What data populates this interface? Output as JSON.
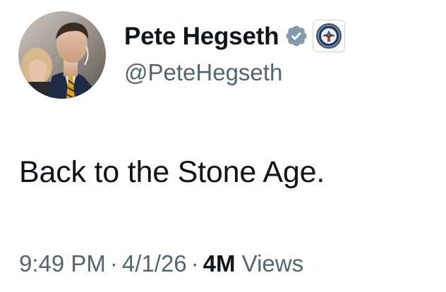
{
  "author": {
    "display_name": "Pete Hegseth",
    "handle": "@PeteHegseth",
    "verified_badge_icon": "verified-gray-badge-icon",
    "verified_badge_color": "#829aab",
    "affiliate_badge_icon": "government-seal-icon",
    "avatar": "profile-photo"
  },
  "tweet": {
    "text": "Back to the Stone Age."
  },
  "meta": {
    "time": "9:49 PM",
    "separator": "·",
    "date": "4/1/26",
    "views_count": "4M",
    "views_label": "Views"
  },
  "colors": {
    "text_primary": "#0f1419",
    "text_secondary": "#536471",
    "background": "#ffffff"
  }
}
